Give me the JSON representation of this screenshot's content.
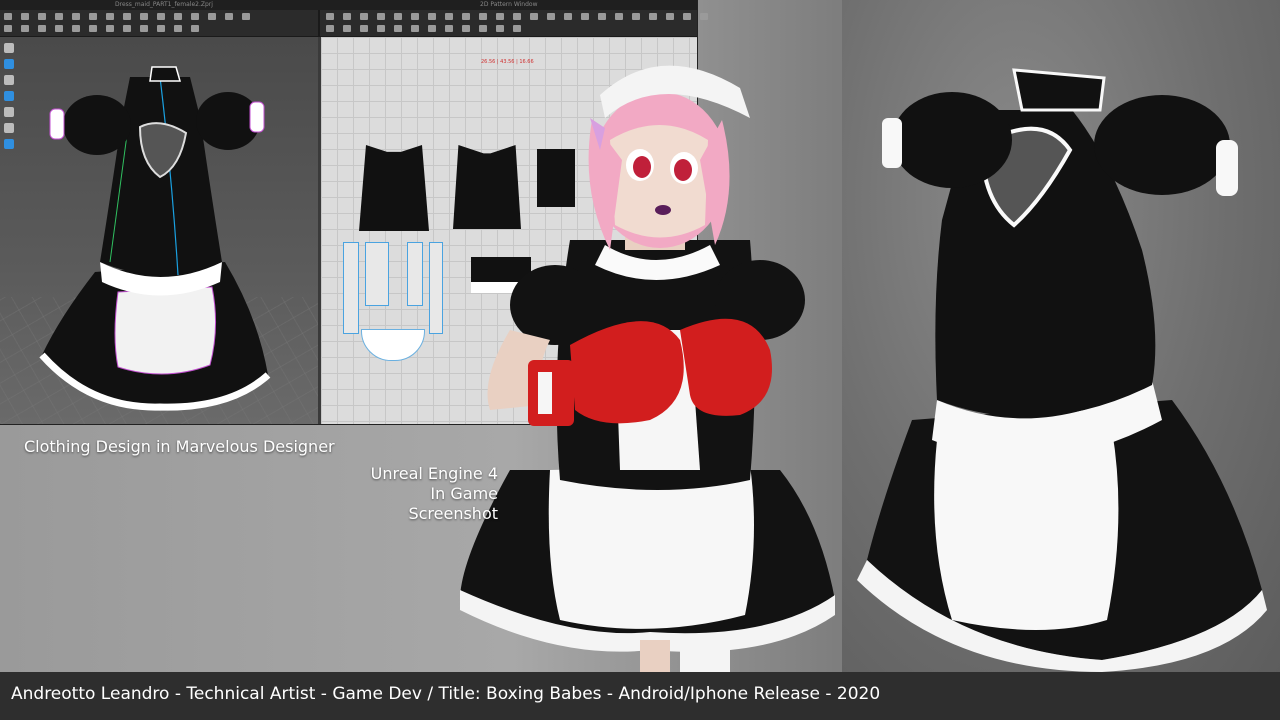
{
  "md_window": {
    "left_title": "Dress_maid_PART1_female2.Zprj",
    "right_title": "2D Pattern Window",
    "pattern_readout": "26.56 | 43.56 | 16.66"
  },
  "captions": {
    "marvelous": "Clothing Design in Marvelous Designer",
    "unreal_line1": "Unreal Engine 4",
    "unreal_line2": "In Game",
    "unreal_line3": "Screenshot"
  },
  "footer": {
    "text": "Andreotto Leandro - Technical Artist - Game Dev  /  Title: Boxing Babes - Android/Iphone Release - 2020"
  },
  "colors": {
    "accent_blue": "#2f8fe0",
    "pattern_red": "#d03030",
    "glove_red": "#d21e1e",
    "hair_pink": "#f2a9c4"
  }
}
